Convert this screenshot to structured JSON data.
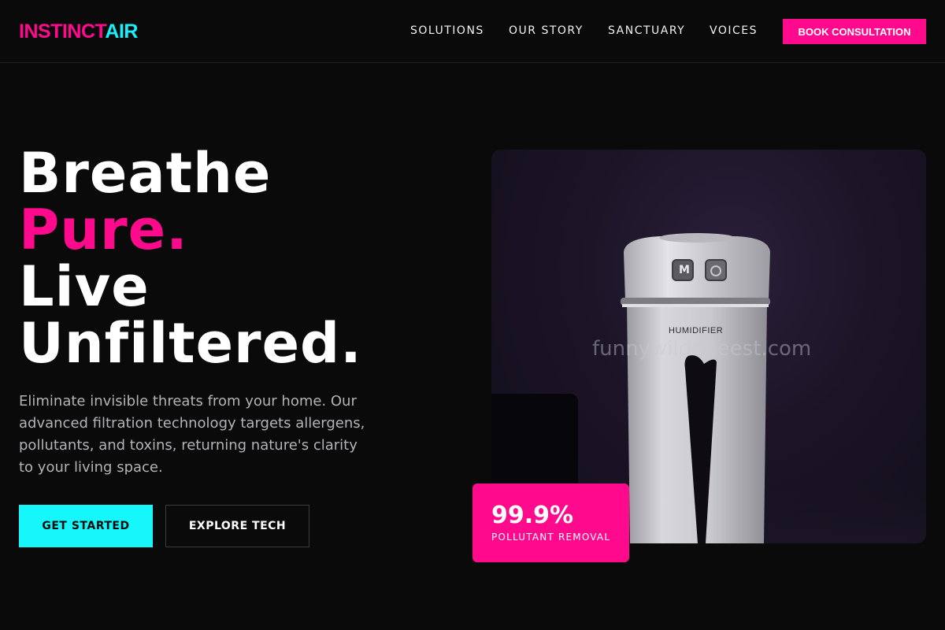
{
  "brand": {
    "logo_part1": "INSTINCT",
    "logo_part2": "AIR"
  },
  "nav": {
    "items": [
      {
        "label": "SOLUTIONS"
      },
      {
        "label": "OUR STORY"
      },
      {
        "label": "SANCTUARY"
      },
      {
        "label": "VOICES"
      }
    ],
    "cta_label": "BOOK CONSULTATION"
  },
  "hero": {
    "headline_line1": "Breathe",
    "headline_line2": "Pure.",
    "headline_line3": "Live",
    "headline_line4": "Unfiltered.",
    "description": "Eliminate invisible threats from your home. Our advanced filtration technology targets allergens, pollutants, and toxins, returning nature's clarity to your living space.",
    "primary_button": "GET STARTED",
    "secondary_button": "EXPLORE TECH"
  },
  "image": {
    "device_label": "HUMIDIFIER",
    "button_m": "M",
    "watermark": "funnywildebeest.com"
  },
  "stat": {
    "value": "99.9%",
    "label": "POLLUTANT REMOVAL"
  },
  "colors": {
    "background": "#0a0a0b",
    "accent_pink": "#ff0a8c",
    "accent_cyan": "#16f7fb"
  }
}
